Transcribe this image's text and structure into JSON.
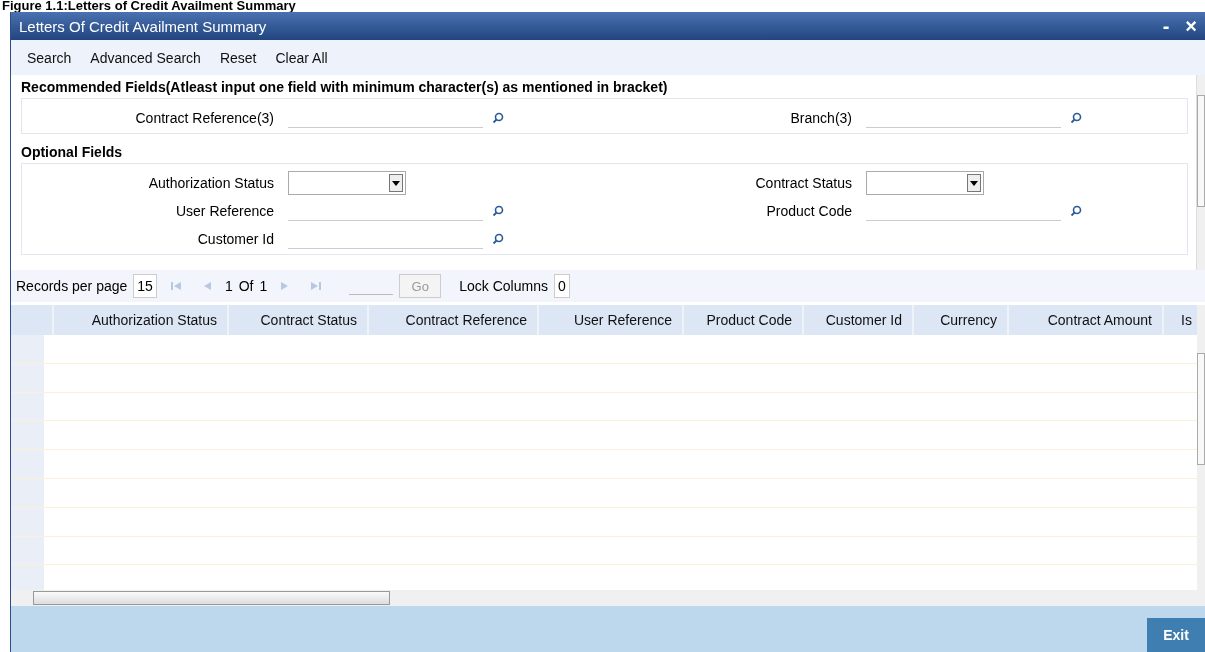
{
  "caption": "Figure 1.1:Letters of Credit Availment Summary",
  "window": {
    "title": "Letters Of Credit Availment Summary",
    "minimize": "-",
    "close": "×"
  },
  "toolbar": [
    "Search",
    "Advanced Search",
    "Reset",
    "Clear All"
  ],
  "recommended": {
    "title": "Recommended Fields(Atleast input one field with minimum character(s) as mentioned in bracket)",
    "fields": [
      {
        "label": "Contract Reference(3)",
        "kind": "lookup"
      },
      {
        "label": "Branch(3)",
        "kind": "lookup"
      }
    ]
  },
  "optional": {
    "title": "Optional Fields",
    "fields": [
      {
        "label": "Authorization Status",
        "kind": "select"
      },
      {
        "label": "Contract Status",
        "kind": "select"
      },
      {
        "label": "User Reference",
        "kind": "lookup"
      },
      {
        "label": "Product Code",
        "kind": "lookup"
      },
      {
        "label": "Customer Id",
        "kind": "lookup"
      }
    ]
  },
  "pagination": {
    "records_label": "Records per page",
    "records_value": "15",
    "page": "1",
    "of": "Of",
    "total": "1",
    "go": "Go",
    "lock_label": "Lock Columns",
    "lock_value": "0"
  },
  "table": {
    "columns": [
      "Authorization Status",
      "Contract Status",
      "Contract Reference",
      "User Reference",
      "Product Code",
      "Customer Id",
      "Currency",
      "Contract Amount",
      "Is"
    ]
  },
  "footer": {
    "exit": "Exit"
  }
}
